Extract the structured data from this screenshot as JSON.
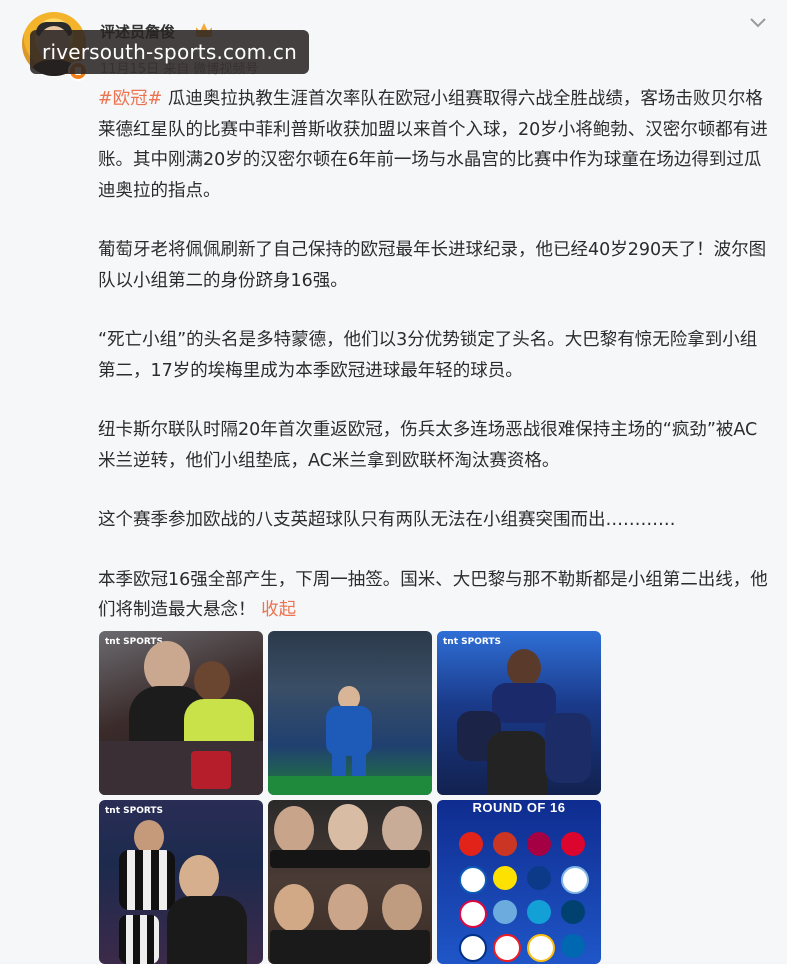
{
  "watermark": "riversouth-sports.com.cn",
  "post": {
    "username": "评述员詹俊",
    "subline": "11月15日 来自 微博视频号",
    "paragraphs": [
      {
        "tag": "#欧冠#",
        "text": " 瓜迪奥拉执教生涯首次率队在欧冠小组赛取得六战全胜战绩，客场击败贝尔格莱德红星队的比赛中菲利普斯收获加盟以来首个入球，20岁小将鲍勃、汉密尔顿都有进账。其中刚满20岁的汉密尔顿在6年前一场与水晶宫的比赛中作为球童在场边得到过瓜迪奥拉的指点。"
      },
      {
        "tag": "",
        "text": "葡萄牙老将佩佩刷新了自己保持的欧冠最年长进球纪录，他已经40岁290天了！波尔图队以小组第二的身份跻身16强。"
      },
      {
        "tag": "",
        "text": "“死亡小组”的头名是多特蒙德，他们以3分优势锁定了头名。大巴黎有惊无险拿到小组第二，17岁的埃梅里成为本季欧冠进球最年轻的球员。"
      },
      {
        "tag": "",
        "text": "纽卡斯尔联队时隔20年首次重返欧冠，伤兵太多连场恶战很难保持主场的“疯劲”被AC米兰逆转，他们小组垫底，AC米兰拿到欧联杯淘汰赛资格。"
      },
      {
        "tag": "",
        "text": "这个赛季参加欧战的八支英超球队只有两队无法在小组赛突围而出…………"
      },
      {
        "tag": "",
        "text": "本季欧冠16强全部产生，下周一抽签。国米、大巴黎与那不勒斯都是小组第二出线，他们将制造最大悬念！"
      }
    ],
    "collapse_label": "收起"
  },
  "images": [
    {
      "name": "image-guardiola-coaching",
      "badge": "tnt SPORTS"
    },
    {
      "name": "image-porto-celebration",
      "badge": ""
    },
    {
      "name": "image-psg-players",
      "badge": "tnt SPORTS"
    },
    {
      "name": "image-newcastle-players",
      "badge": "tnt SPORTS"
    },
    {
      "name": "image-english-coaches",
      "badge": ""
    },
    {
      "name": "image-round-of-16",
      "badge": "ROUND OF 16"
    }
  ],
  "colors": {
    "accent": "#eb7350",
    "text": "#2c2c2c"
  }
}
